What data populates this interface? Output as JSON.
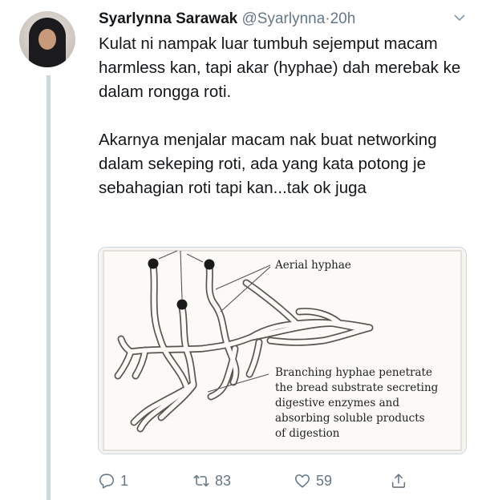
{
  "user": {
    "display_name": "Syarlynna Sarawak",
    "handle": "@Syarlynna",
    "separator": "·",
    "time": "20h"
  },
  "tweet": {
    "paragraph_1": "Kulat ni nampak luar tumbuh sejemput macam harmless kan, tapi akar (hyphae) dah merebak ke dalam rongga roti.",
    "paragraph_2": "Akarnya menjalar macam nak buat networking dalam sekeping roti, ada yang kata potong je sebahagian roti tapi kan...tak ok juga"
  },
  "image": {
    "label_aerial": "Aerial hyphae",
    "label_branching": [
      "Branching hyphae penetrate",
      "the bread substrate secreting",
      "digestive enzymes and",
      "absorbing soluble products",
      "of digestion"
    ]
  },
  "actions": {
    "replies": "1",
    "retweets": "83",
    "likes": "59"
  },
  "icons": {
    "reply": "reply-icon",
    "retweet": "retweet-icon",
    "like": "like-icon",
    "share": "share-icon",
    "menu": "chevron-down-icon"
  },
  "colors": {
    "text": "#14171a",
    "secondary": "#657786",
    "thread_line": "#ccd6dd"
  }
}
